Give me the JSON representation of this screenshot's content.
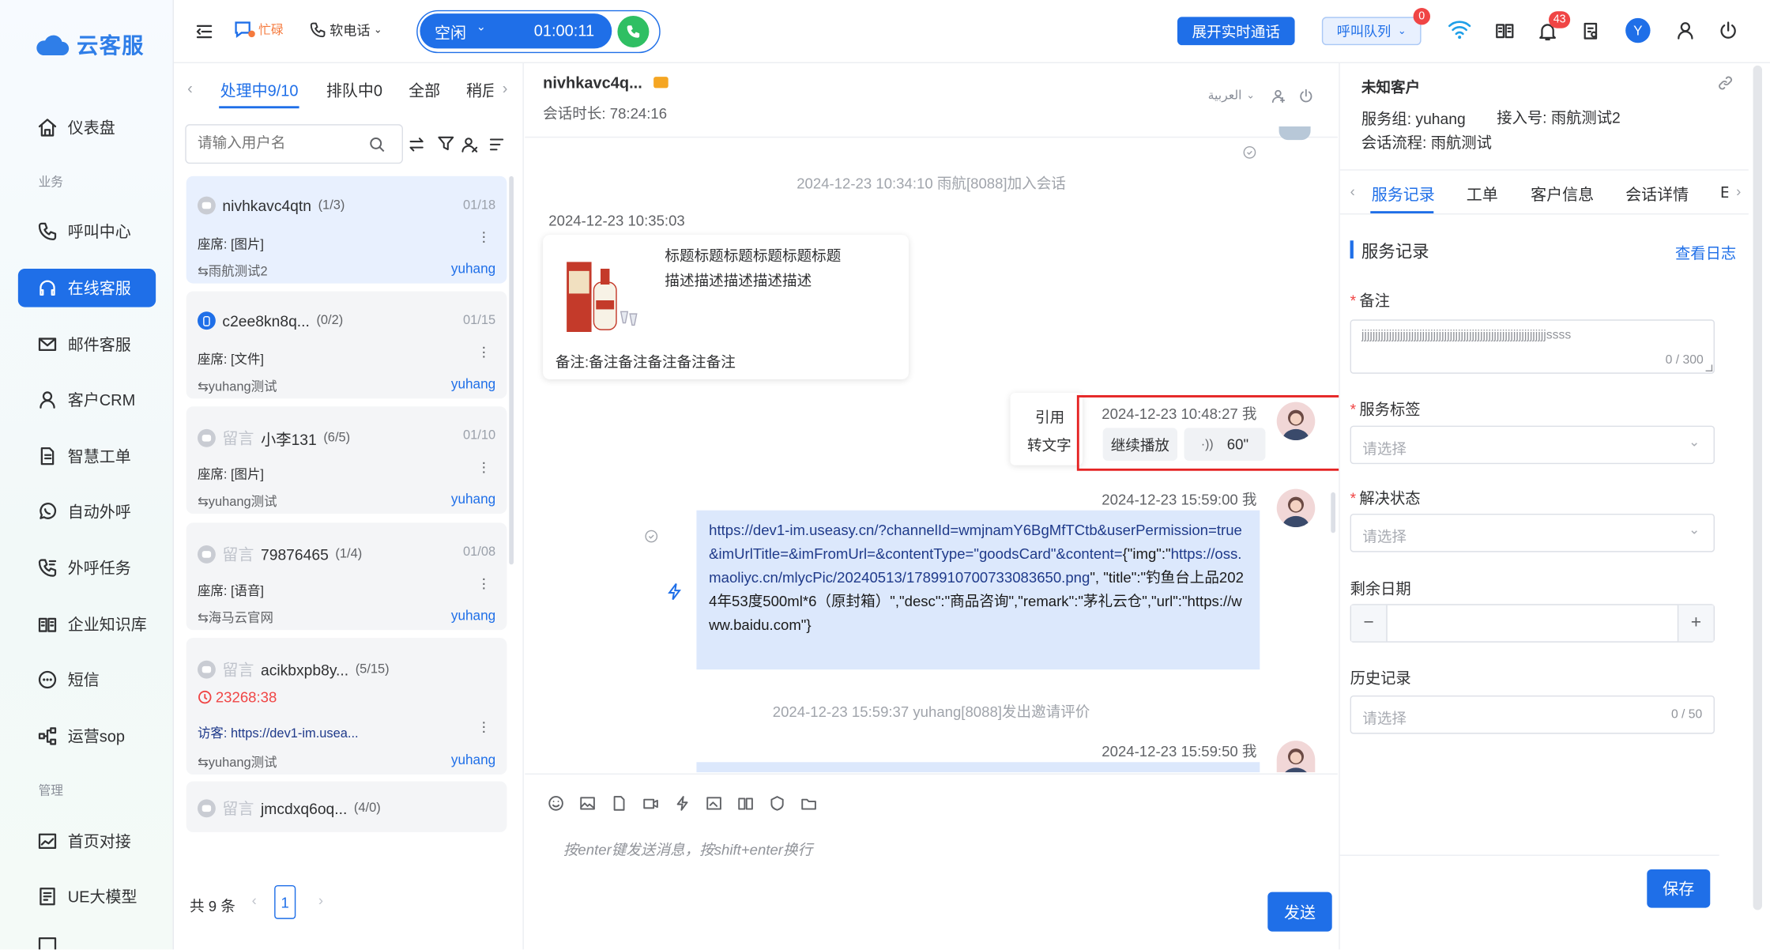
{
  "app": {
    "brand": "云客服",
    "brand_color": "#2f7ee8",
    "accent": "#1f6fe8"
  },
  "sidebar": {
    "items": [
      {
        "label": "仪表盘",
        "icon": "home-icon"
      },
      {
        "section": "业务"
      },
      {
        "label": "呼叫中心",
        "icon": "phone-icon"
      },
      {
        "label": "在线客服",
        "icon": "headset-icon",
        "active": true
      },
      {
        "label": "邮件客服",
        "icon": "mail-icon"
      },
      {
        "label": "客户CRM",
        "icon": "user-icon"
      },
      {
        "label": "智慧工单",
        "icon": "document-icon"
      },
      {
        "label": "自动外呼",
        "icon": "whatsapp-icon"
      },
      {
        "label": "外呼任务",
        "icon": "phone-task-icon"
      },
      {
        "label": "企业知识库",
        "icon": "book-icon"
      },
      {
        "label": "短信",
        "icon": "sms-icon"
      },
      {
        "label": "运营sop",
        "icon": "flow-icon"
      },
      {
        "section": "管理"
      },
      {
        "label": "首页对接",
        "icon": "chart-icon"
      },
      {
        "label": "UE大模型",
        "icon": "model-icon"
      }
    ],
    "section_business": "业务",
    "section_manage": "管理"
  },
  "topbar": {
    "status_busy": "忙碌",
    "softphone": "软电话",
    "call_state": "空闲",
    "call_timer": "01:00:11",
    "realtime_btn": "展开实时通话",
    "queue_btn": "呼叫队列",
    "queue_count": "0",
    "notif_count": "43",
    "user_initial": "Y"
  },
  "list": {
    "tabs": [
      "处理中9/10",
      "排队中0",
      "全部",
      "稍后"
    ],
    "search_placeholder": "请输入用户名",
    "cards": [
      {
        "name": "nivhkavc4qtn",
        "count": "(1/3)",
        "date": "01/18",
        "line": "座席: [图片]",
        "group": "雨航测试2",
        "agent": "yuhang",
        "tag": "",
        "alert": ""
      },
      {
        "name": "c2ee8kn8q...",
        "count": "(0/2)",
        "date": "01/15",
        "line": "座席: [文件]",
        "group": "yuhang测试",
        "agent": "yuhang",
        "tag": "",
        "alert": ""
      },
      {
        "name": "小李131",
        "count": "(6/5)",
        "date": "01/10",
        "line": "座席: [图片]",
        "group": "yuhang测试",
        "agent": "yuhang",
        "tag": "留言",
        "alert": ""
      },
      {
        "name": "79876465",
        "count": "(1/4)",
        "date": "01/08",
        "line": "座席: [语音]",
        "group": "海马云官网",
        "agent": "yuhang",
        "tag": "留言",
        "alert": ""
      },
      {
        "name": "acikbxpb8y...",
        "count": "(5/15)",
        "date": "",
        "line": "访客: https://dev1-im.usea...",
        "group": "yuhang测试",
        "agent": "yuhang",
        "tag": "留言",
        "alert": "23268:38"
      },
      {
        "name": "jmcdxq6oq...",
        "count": "(4/0)",
        "date": "",
        "line": "",
        "group": "",
        "agent": "",
        "tag": "留言",
        "alert": ""
      }
    ],
    "total": "共 9 条",
    "page": "1"
  },
  "chat": {
    "title": "nivhkavc4q...",
    "duration": "会话时长: 78:24:16",
    "lang": "العربية",
    "sys1": "2024-12-23 10:34:10 雨航[8088]加入会话",
    "ts1": "2024-12-23 10:35:03",
    "product_title": "标题标题标题标题标题标题",
    "product_desc": "描述描述描述描述描述",
    "product_note": "备注:备注备注备注备注备注",
    "menu_quote": "引用",
    "menu_totext": "转文字",
    "ts2": "2024-12-23 10:48:27 我",
    "voice_continue": "继续播放",
    "voice_len": "60\"",
    "ts3": "2024-12-23 15:59:00 我",
    "msg_link1": "https://dev1-im.useasy.cn/?channelId=wmjnamY6BgMfTCtb&userPermission=true&imUrlTitle=&imFromUrl=&contentType=\"goodsCard\"&content=",
    "msg_json_a": "{\"img\":\"",
    "msg_link2": "https://oss.maoliyc.cn/mlycPic/20240513/1789910700733083650.png",
    "msg_json_b": "\", \"title\":\"钓鱼台上品2024年53度500ml*6（原封箱）\",\"desc\":\"商品咨询\",\"remark\":\"茅礼云仓\",\"url\":\"https://www.baidu.com\"}",
    "sys2": "2024-12-23 15:59:37 yuhang[8088]发出邀请评价",
    "ts4": "2024-12-23 15:59:50 我",
    "input_placeholder": "按enter键发送消息，按shift+enter换行",
    "send": "发送"
  },
  "right": {
    "customer": "未知客户",
    "service_group": "服务组: yuhang",
    "access": "接入号: 雨航测试2",
    "flow": "会话流程: 雨航测试",
    "tabs": [
      "服务记录",
      "工单",
      "客户信息",
      "会话详情",
      "E"
    ],
    "section": "服务记录",
    "view_log": "查看日志",
    "note_label": "备注",
    "note_value": "jjjjjjjjjjjjjjjjjjjjjjjjjjjjjjjjjjjjjjjjjjjjjjjjjjjjjjjjjjjjjjjjjjjssss",
    "note_count": "0 / 300",
    "tag_label": "服务标签",
    "select_ph": "请选择",
    "status_label": "解决状态",
    "remain_label": "剩余日期",
    "history_label": "历史记录",
    "history_count": "0 / 50",
    "save": "保存"
  }
}
